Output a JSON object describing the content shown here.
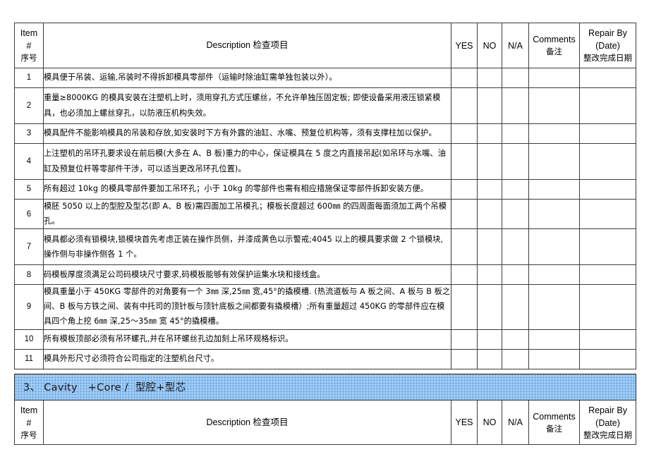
{
  "document": {
    "type": "mold-inspection-checklist",
    "page_background": "#ffffff",
    "accent_color": "#9ecbf7"
  },
  "table_header": {
    "item_en_line1": "Item",
    "item_en_line2": "#",
    "item_cn": "序号",
    "description_en": "Description",
    "description_cn": "检查项目",
    "yes": "YES",
    "no": "NO",
    "na": "N/A",
    "comments_en": "Comments",
    "comments_cn": "备注",
    "repair_en_line1": "Repair By",
    "repair_en_line2": "(Date)",
    "repair_cn": "整改完成日期"
  },
  "rows": [
    {
      "num": "1",
      "desc": "模具便于吊装、运输,吊装时不得拆卸模具零部件（运输时除油缸需单独包装以外）。",
      "yes": "",
      "no": "",
      "na": "",
      "comments": "",
      "repair": ""
    },
    {
      "num": "2",
      "desc": "重量≥8000KG 的模具安装在注塑机上时，须用穿孔方式压螺丝，不允许单独压固定板; 即使设备采用液压锁紧模具，也必须加上螺丝穿孔，以防液压机构失效。",
      "yes": "",
      "no": "",
      "na": "",
      "comments": "",
      "repair": ""
    },
    {
      "num": "3",
      "desc": "模具配件不能影响模具的吊装和存放,如安装时下方有外露的油缸、水嘴、预复位机构等，须有支撑柱加以保护。",
      "yes": "",
      "no": "",
      "na": "",
      "comments": "",
      "repair": ""
    },
    {
      "num": "4",
      "desc": "上注塑机的吊环孔要求设在前后模(大多在 A、B 板)重力的中心，保证模具在 5 度之内直接吊起(如吊环与水嘴、油缸及预复位杆等零部件干涉，可以适当更改吊环孔位置)。",
      "yes": "",
      "no": "",
      "na": "",
      "comments": "",
      "repair": ""
    },
    {
      "num": "5",
      "desc": "所有超过 10kg 的模具零部件要加工吊环孔；小于 10kg 的零部件也需有相应措施保证零部件拆卸安装方便。",
      "yes": "",
      "no": "",
      "na": "",
      "comments": "",
      "repair": ""
    },
    {
      "num": "6",
      "desc": "模胚 5050 以上的型腔及型芯(即 A、B 板)需四面加工吊模孔；模板长度超过 600㎜ 的四周面每面须加工两个吊模孔。",
      "yes": "",
      "no": "",
      "na": "",
      "comments": "",
      "repair": ""
    },
    {
      "num": "7",
      "desc": "模具都必须有锁模块,锁模块首先考虑正装在操作员侧，并漆成黄色以示警戒;4045 以上的模具要求做 2 个锁模块,操作侧与非操作侧各 1 个。",
      "yes": "",
      "no": "",
      "na": "",
      "comments": "",
      "repair": ""
    },
    {
      "num": "8",
      "desc": "码模板厚度须满足公司码模块尺寸要求,码模板能够有效保护运集水块和接线盒。",
      "yes": "",
      "no": "",
      "na": "",
      "comments": "",
      "repair": ""
    },
    {
      "num": "9",
      "desc": "模具重量小于 450KG 零部件的对角要有一个 3㎜ 深,25㎜ 宽,45°的撬模槽. (热流道板与 A 板之间、A 板与 B 板之间、B 板与方铁之间、装有中托司的顶针板与顶针底板之间都要有撬模槽）;所有重量超过 450KG 的零部件应在模具四个角上挖 6㎜ 深,25～35㎜ 宽 45°的撬模槽。",
      "yes": "",
      "no": "",
      "na": "",
      "comments": "",
      "repair": ""
    },
    {
      "num": "10",
      "desc": "所有模板顶部必须有吊环螺孔,并在吊环螺丝孔边加刻上吊环规格标识。",
      "yes": "",
      "no": "",
      "na": "",
      "comments": "",
      "repair": ""
    },
    {
      "num": "11",
      "desc": "模具外形尺寸必须符合公司指定的注塑机台尺寸。",
      "yes": "",
      "no": "",
      "na": "",
      "comments": "",
      "repair": ""
    }
  ],
  "section": {
    "number": "3、",
    "title_en": "Cavity   +Core / ",
    "title_cn": "型腔+型芯",
    "full_label": "3、 Cavity   +Core /  型腔+型芯"
  }
}
